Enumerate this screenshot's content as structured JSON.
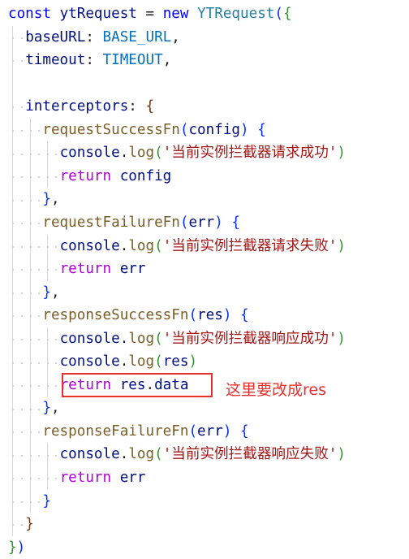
{
  "code": {
    "lines": [
      [
        {
          "t": "const",
          "c": "kw"
        },
        {
          "t": " ",
          "c": "punc"
        },
        {
          "t": "ytRequest",
          "c": "var"
        },
        {
          "t": " = ",
          "c": "punc"
        },
        {
          "t": "new",
          "c": "kw"
        },
        {
          "t": " ",
          "c": "punc"
        },
        {
          "t": "YTRequest",
          "c": "cls"
        },
        {
          "t": "(",
          "c": "br1"
        },
        {
          "t": "{",
          "c": "br2"
        }
      ],
      [
        {
          "t": "  ",
          "c": "punc"
        },
        {
          "t": "baseURL",
          "c": "prop"
        },
        {
          "t": ": ",
          "c": "punc"
        },
        {
          "t": "BASE_URL",
          "c": "const"
        },
        {
          "t": ",",
          "c": "punc"
        }
      ],
      [
        {
          "t": "  ",
          "c": "punc"
        },
        {
          "t": "timeout",
          "c": "prop"
        },
        {
          "t": ": ",
          "c": "punc"
        },
        {
          "t": "TIMEOUT",
          "c": "const"
        },
        {
          "t": ",",
          "c": "punc"
        }
      ],
      [],
      [
        {
          "t": "  ",
          "c": "punc"
        },
        {
          "t": "interceptors",
          "c": "prop"
        },
        {
          "t": ": ",
          "c": "punc"
        },
        {
          "t": "{",
          "c": "br3"
        }
      ],
      [
        {
          "t": "    ",
          "c": "punc"
        },
        {
          "t": "requestSuccessFn",
          "c": "fn"
        },
        {
          "t": "(",
          "c": "br1"
        },
        {
          "t": "config",
          "c": "var"
        },
        {
          "t": ")",
          "c": "br1"
        },
        {
          "t": " ",
          "c": "punc"
        },
        {
          "t": "{",
          "c": "br1"
        }
      ],
      [
        {
          "t": "      ",
          "c": "punc"
        },
        {
          "t": "console",
          "c": "var"
        },
        {
          "t": ".",
          "c": "punc"
        },
        {
          "t": "log",
          "c": "fn"
        },
        {
          "t": "(",
          "c": "br2"
        },
        {
          "t": "'当前实例拦截器请求成功'",
          "c": "str"
        },
        {
          "t": ")",
          "c": "br2"
        }
      ],
      [
        {
          "t": "      ",
          "c": "punc"
        },
        {
          "t": "return",
          "c": "ret"
        },
        {
          "t": " ",
          "c": "punc"
        },
        {
          "t": "config",
          "c": "var"
        }
      ],
      [
        {
          "t": "    ",
          "c": "punc"
        },
        {
          "t": "}",
          "c": "br1"
        },
        {
          "t": ",",
          "c": "punc"
        }
      ],
      [
        {
          "t": "    ",
          "c": "punc"
        },
        {
          "t": "requestFailureFn",
          "c": "fn"
        },
        {
          "t": "(",
          "c": "br1"
        },
        {
          "t": "err",
          "c": "var"
        },
        {
          "t": ")",
          "c": "br1"
        },
        {
          "t": " ",
          "c": "punc"
        },
        {
          "t": "{",
          "c": "br1"
        }
      ],
      [
        {
          "t": "      ",
          "c": "punc"
        },
        {
          "t": "console",
          "c": "var"
        },
        {
          "t": ".",
          "c": "punc"
        },
        {
          "t": "log",
          "c": "fn"
        },
        {
          "t": "(",
          "c": "br2"
        },
        {
          "t": "'当前实例拦截器请求失败'",
          "c": "str"
        },
        {
          "t": ")",
          "c": "br2"
        }
      ],
      [
        {
          "t": "      ",
          "c": "punc"
        },
        {
          "t": "return",
          "c": "ret"
        },
        {
          "t": " ",
          "c": "punc"
        },
        {
          "t": "err",
          "c": "var"
        }
      ],
      [
        {
          "t": "    ",
          "c": "punc"
        },
        {
          "t": "}",
          "c": "br1"
        },
        {
          "t": ",",
          "c": "punc"
        }
      ],
      [
        {
          "t": "    ",
          "c": "punc"
        },
        {
          "t": "responseSuccessFn",
          "c": "fn"
        },
        {
          "t": "(",
          "c": "br1"
        },
        {
          "t": "res",
          "c": "var"
        },
        {
          "t": ")",
          "c": "br1"
        },
        {
          "t": " ",
          "c": "punc"
        },
        {
          "t": "{",
          "c": "br1"
        }
      ],
      [
        {
          "t": "      ",
          "c": "punc"
        },
        {
          "t": "console",
          "c": "var"
        },
        {
          "t": ".",
          "c": "punc"
        },
        {
          "t": "log",
          "c": "fn"
        },
        {
          "t": "(",
          "c": "br2"
        },
        {
          "t": "'当前实例拦截器响应成功'",
          "c": "str"
        },
        {
          "t": ")",
          "c": "br2"
        }
      ],
      [
        {
          "t": "      ",
          "c": "punc"
        },
        {
          "t": "console",
          "c": "var"
        },
        {
          "t": ".",
          "c": "punc"
        },
        {
          "t": "log",
          "c": "fn"
        },
        {
          "t": "(",
          "c": "br2"
        },
        {
          "t": "res",
          "c": "var"
        },
        {
          "t": ")",
          "c": "br2"
        }
      ],
      [
        {
          "t": "      ",
          "c": "punc"
        },
        {
          "t": "return",
          "c": "ret"
        },
        {
          "t": " ",
          "c": "punc"
        },
        {
          "t": "res",
          "c": "var"
        },
        {
          "t": ".",
          "c": "punc"
        },
        {
          "t": "data",
          "c": "var"
        }
      ],
      [
        {
          "t": "    ",
          "c": "punc"
        },
        {
          "t": "}",
          "c": "br1"
        },
        {
          "t": ",",
          "c": "punc"
        }
      ],
      [
        {
          "t": "    ",
          "c": "punc"
        },
        {
          "t": "responseFailureFn",
          "c": "fn"
        },
        {
          "t": "(",
          "c": "br1"
        },
        {
          "t": "err",
          "c": "var"
        },
        {
          "t": ")",
          "c": "br1"
        },
        {
          "t": " ",
          "c": "punc"
        },
        {
          "t": "{",
          "c": "br1"
        }
      ],
      [
        {
          "t": "      ",
          "c": "punc"
        },
        {
          "t": "console",
          "c": "var"
        },
        {
          "t": ".",
          "c": "punc"
        },
        {
          "t": "log",
          "c": "fn"
        },
        {
          "t": "(",
          "c": "br2"
        },
        {
          "t": "'当前实例拦截器响应失败'",
          "c": "str"
        },
        {
          "t": ")",
          "c": "br2"
        }
      ],
      [
        {
          "t": "      ",
          "c": "punc"
        },
        {
          "t": "return",
          "c": "ret"
        },
        {
          "t": " ",
          "c": "punc"
        },
        {
          "t": "err",
          "c": "var"
        }
      ],
      [
        {
          "t": "    ",
          "c": "punc"
        },
        {
          "t": "}",
          "c": "br1"
        }
      ],
      [
        {
          "t": "  ",
          "c": "punc"
        },
        {
          "t": "}",
          "c": "br3"
        }
      ],
      [
        {
          "t": "}",
          "c": "br2"
        },
        {
          "t": ")",
          "c": "br1"
        }
      ]
    ]
  },
  "annotation": {
    "text": "这里要改成res",
    "color": "#e8312f"
  }
}
